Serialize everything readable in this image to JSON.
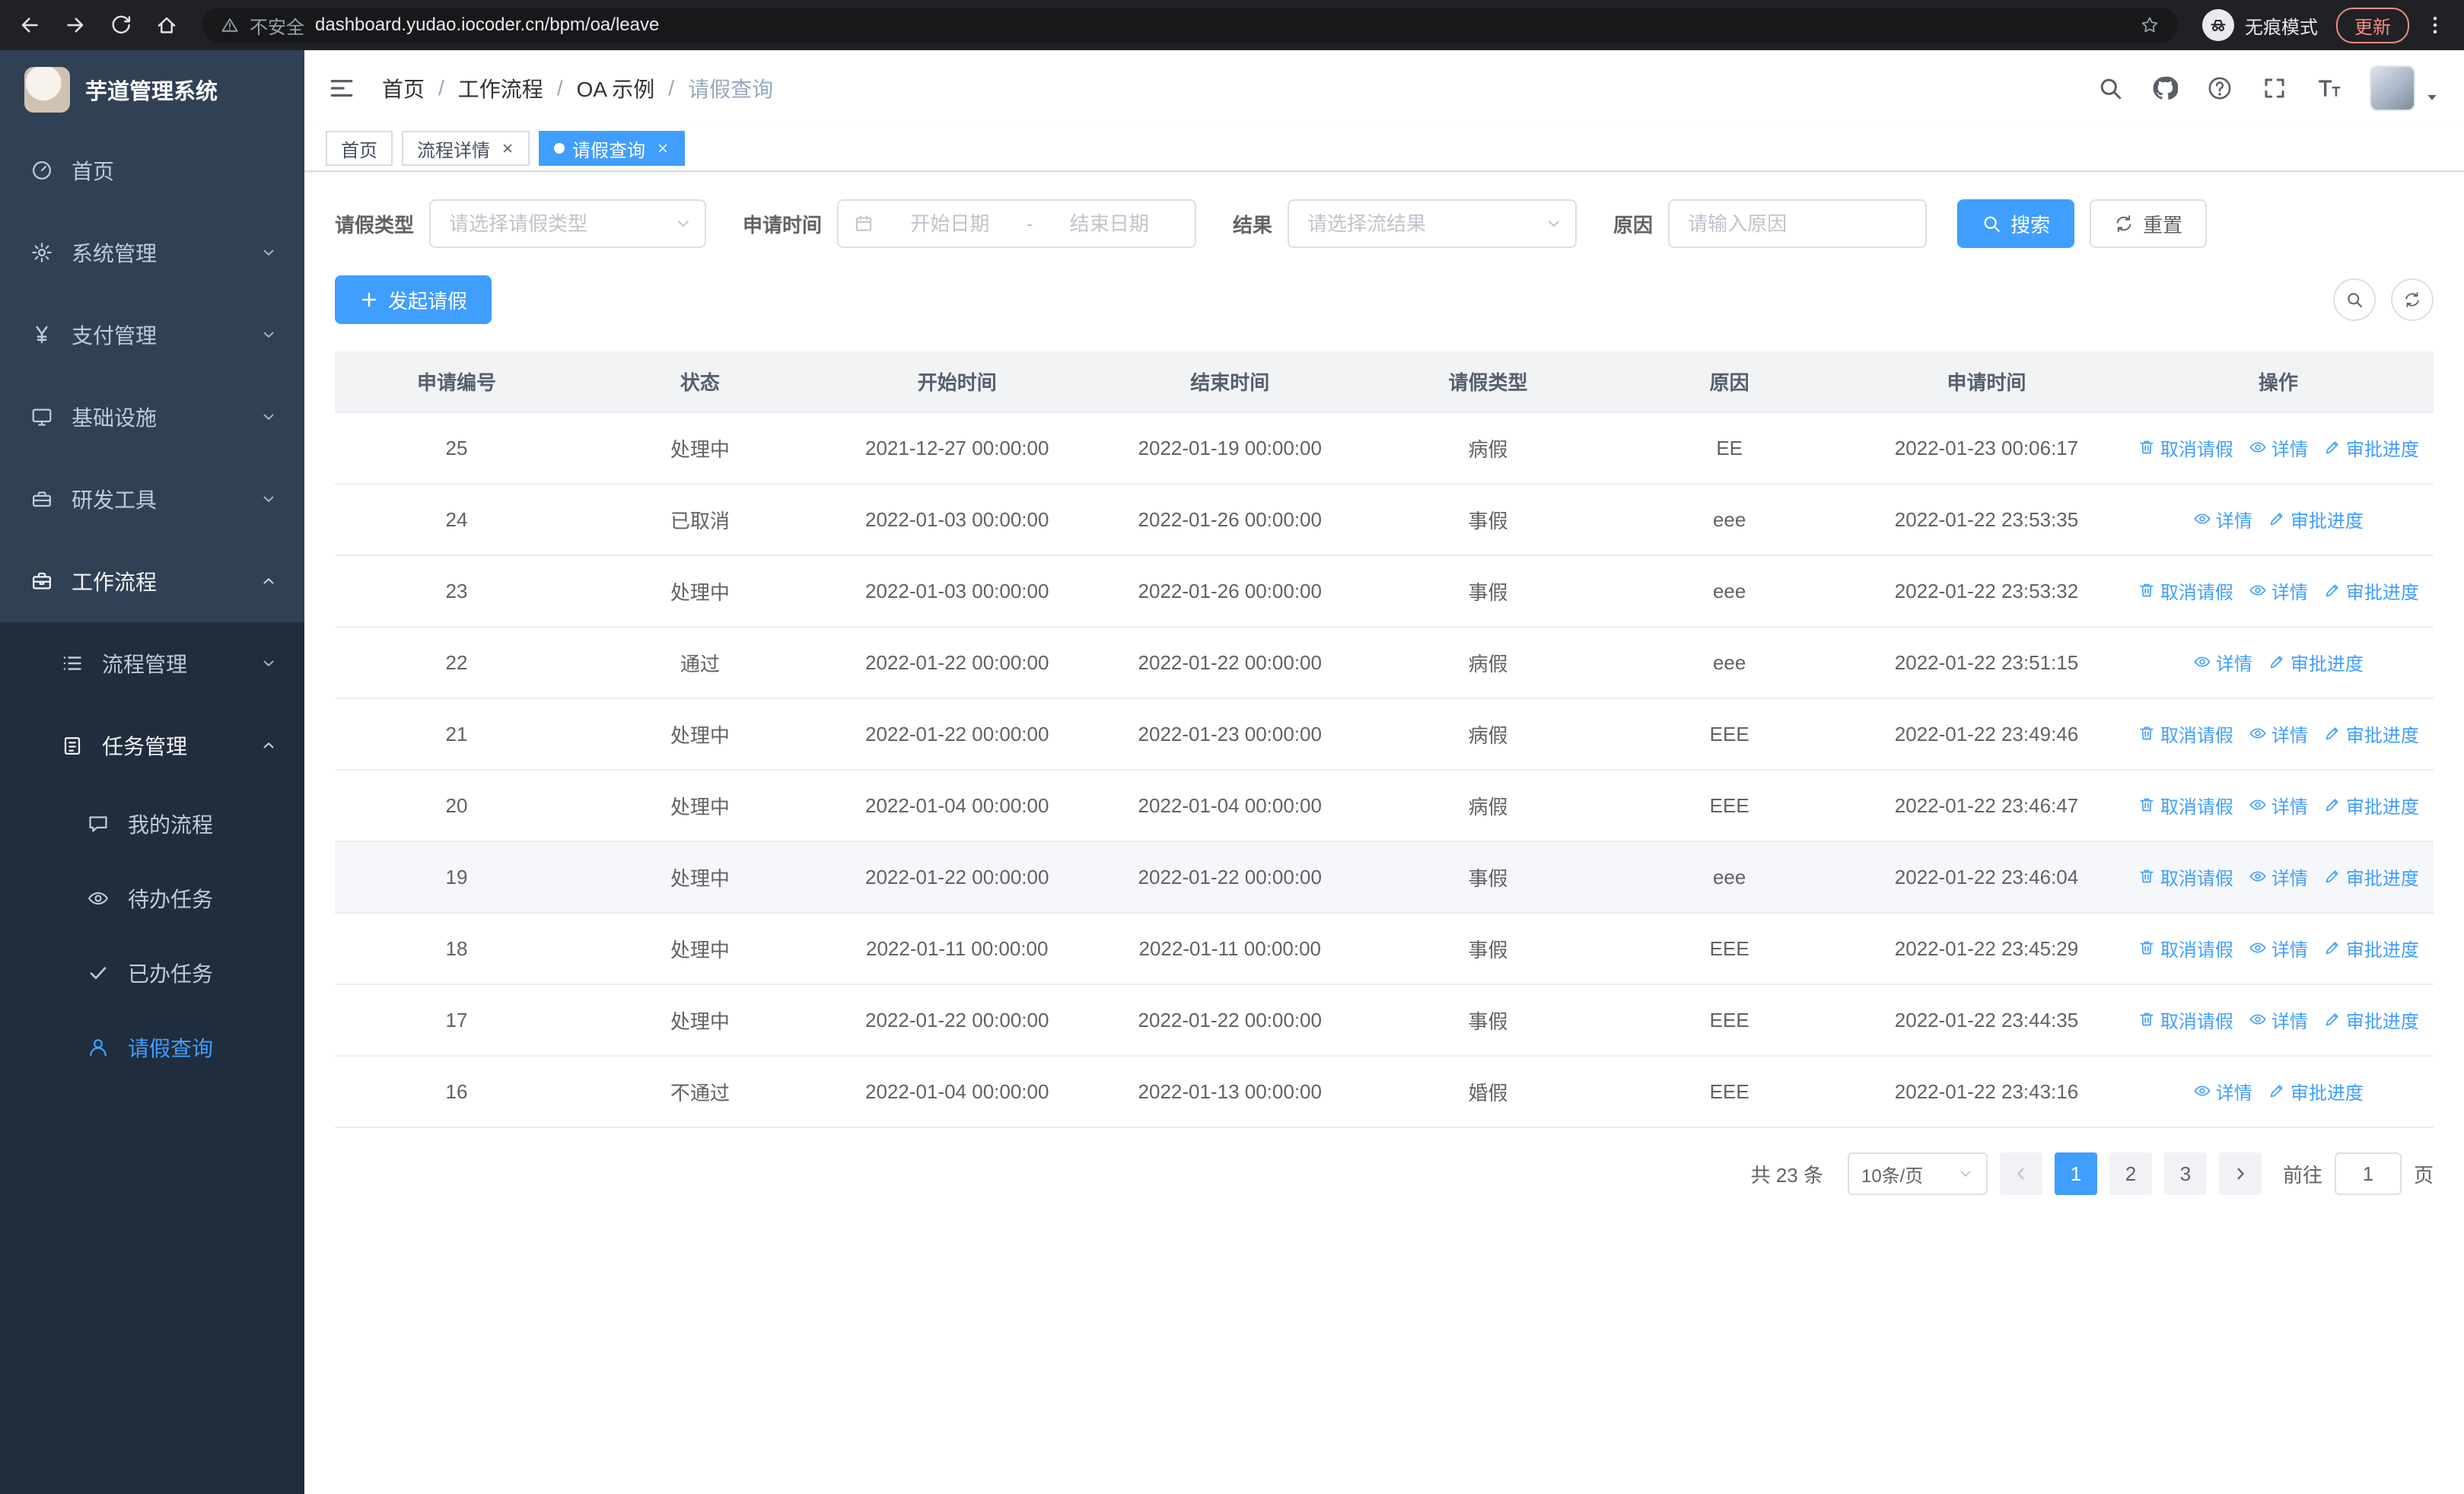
{
  "colors": {
    "accent": "#409eff",
    "sidebar_bg": "#304156",
    "submenu_bg": "#1f2d3d",
    "table_header_bg": "#f2f3f5",
    "highlight_row_bg": "#f5f7fa",
    "chrome_bg": "#202124",
    "update_pill": "#f28b82"
  },
  "browser": {
    "nav_icons": [
      "back-icon",
      "forward-icon",
      "reload-icon",
      "home-icon"
    ],
    "security_label": "不安全",
    "url": "dashboard.yudao.iocoder.cn/bpm/oa/leave",
    "incognito_label": "无痕模式",
    "update_label": "更新"
  },
  "sidebar": {
    "logo_title": "芋道管理系统",
    "items": [
      {
        "key": "home",
        "label": "首页",
        "icon": "dashboard-icon"
      },
      {
        "key": "system",
        "label": "系统管理",
        "icon": "gear-icon",
        "chevron": true
      },
      {
        "key": "payment",
        "label": "支付管理",
        "icon": "yen-icon",
        "chevron": true
      },
      {
        "key": "infra",
        "label": "基础设施",
        "icon": "monitor-icon",
        "chevron": true
      },
      {
        "key": "devtools",
        "label": "研发工具",
        "icon": "toolbox-icon",
        "chevron": true
      },
      {
        "key": "workflow",
        "label": "工作流程",
        "icon": "briefcase-icon",
        "chevron": true,
        "expanded": true,
        "children": [
          {
            "key": "process-mgmt",
            "label": "流程管理",
            "icon": "list-icon",
            "chevron": true
          },
          {
            "key": "task-mgmt",
            "label": "任务管理",
            "icon": "tasks-icon",
            "chevron": true,
            "expanded": true,
            "children": [
              {
                "key": "my-process",
                "label": "我的流程",
                "icon": "chat-icon"
              },
              {
                "key": "todo-tasks",
                "label": "待办任务",
                "icon": "eye-icon"
              },
              {
                "key": "done-tasks",
                "label": "已办任务",
                "icon": "done-icon"
              },
              {
                "key": "leave-query",
                "label": "请假查询",
                "icon": "user-icon",
                "active": true
              }
            ]
          }
        ]
      }
    ]
  },
  "header": {
    "breadcrumbs": [
      "首页",
      "工作流程",
      "OA 示例",
      "请假查询"
    ],
    "actions": [
      "search-icon",
      "github-icon",
      "question-icon",
      "fullscreen-icon",
      "font-size-icon"
    ]
  },
  "tabs": [
    {
      "label": "首页",
      "closable": false,
      "active": false
    },
    {
      "label": "流程详情",
      "closable": true,
      "active": false
    },
    {
      "label": "请假查询",
      "closable": true,
      "active": true
    }
  ],
  "filters": {
    "leave_type_label": "请假类型",
    "leave_type_placeholder": "请选择请假类型",
    "apply_time_label": "申请时间",
    "start_date_placeholder": "开始日期",
    "date_separator": "-",
    "end_date_placeholder": "结束日期",
    "result_label": "结果",
    "result_placeholder": "请选择流结果",
    "reason_label": "原因",
    "reason_placeholder": "请输入原因",
    "search_label": "搜索",
    "reset_label": "重置"
  },
  "toolbar": {
    "create_label": "发起请假"
  },
  "table": {
    "columns": [
      "申请编号",
      "状态",
      "开始时间",
      "结束时间",
      "请假类型",
      "原因",
      "申请时间",
      "操作"
    ],
    "actions": {
      "cancel": {
        "label": "取消请假",
        "icon": "trash-icon"
      },
      "detail": {
        "label": "详情",
        "icon": "eye-icon"
      },
      "progress": {
        "label": "审批进度",
        "icon": "edit-icon"
      }
    },
    "rows": [
      {
        "id": "25",
        "status": "处理中",
        "start": "2021-12-27 00:00:00",
        "end": "2022-01-19 00:00:00",
        "type": "病假",
        "reason": "EE",
        "applied": "2022-01-23 00:06:17",
        "actions": [
          "cancel",
          "detail",
          "progress"
        ],
        "highlight": false
      },
      {
        "id": "24",
        "status": "已取消",
        "start": "2022-01-03 00:00:00",
        "end": "2022-01-26 00:00:00",
        "type": "事假",
        "reason": "eee",
        "applied": "2022-01-22 23:53:35",
        "actions": [
          "detail",
          "progress"
        ],
        "highlight": false
      },
      {
        "id": "23",
        "status": "处理中",
        "start": "2022-01-03 00:00:00",
        "end": "2022-01-26 00:00:00",
        "type": "事假",
        "reason": "eee",
        "applied": "2022-01-22 23:53:32",
        "actions": [
          "cancel",
          "detail",
          "progress"
        ],
        "highlight": false
      },
      {
        "id": "22",
        "status": "通过",
        "start": "2022-01-22 00:00:00",
        "end": "2022-01-22 00:00:00",
        "type": "病假",
        "reason": "eee",
        "applied": "2022-01-22 23:51:15",
        "actions": [
          "detail",
          "progress"
        ],
        "highlight": false
      },
      {
        "id": "21",
        "status": "处理中",
        "start": "2022-01-22 00:00:00",
        "end": "2022-01-23 00:00:00",
        "type": "病假",
        "reason": "EEE",
        "applied": "2022-01-22 23:49:46",
        "actions": [
          "cancel",
          "detail",
          "progress"
        ],
        "highlight": false
      },
      {
        "id": "20",
        "status": "处理中",
        "start": "2022-01-04 00:00:00",
        "end": "2022-01-04 00:00:00",
        "type": "病假",
        "reason": "EEE",
        "applied": "2022-01-22 23:46:47",
        "actions": [
          "cancel",
          "detail",
          "progress"
        ],
        "highlight": false
      },
      {
        "id": "19",
        "status": "处理中",
        "start": "2022-01-22 00:00:00",
        "end": "2022-01-22 00:00:00",
        "type": "事假",
        "reason": "eee",
        "applied": "2022-01-22 23:46:04",
        "actions": [
          "cancel",
          "detail",
          "progress"
        ],
        "highlight": true
      },
      {
        "id": "18",
        "status": "处理中",
        "start": "2022-01-11 00:00:00",
        "end": "2022-01-11 00:00:00",
        "type": "事假",
        "reason": "EEE",
        "applied": "2022-01-22 23:45:29",
        "actions": [
          "cancel",
          "detail",
          "progress"
        ],
        "highlight": false
      },
      {
        "id": "17",
        "status": "处理中",
        "start": "2022-01-22 00:00:00",
        "end": "2022-01-22 00:00:00",
        "type": "事假",
        "reason": "EEE",
        "applied": "2022-01-22 23:44:35",
        "actions": [
          "cancel",
          "detail",
          "progress"
        ],
        "highlight": false
      },
      {
        "id": "16",
        "status": "不通过",
        "start": "2022-01-04 00:00:00",
        "end": "2022-01-13 00:00:00",
        "type": "婚假",
        "reason": "EEE",
        "applied": "2022-01-22 23:43:16",
        "actions": [
          "detail",
          "progress"
        ],
        "highlight": false
      }
    ]
  },
  "pagination": {
    "total": "共 23 条",
    "page_size": "10条/页",
    "pages": [
      "1",
      "2",
      "3"
    ],
    "active_page": "1",
    "goto_label": "前往",
    "goto_value": "1",
    "unit_label": "页"
  }
}
